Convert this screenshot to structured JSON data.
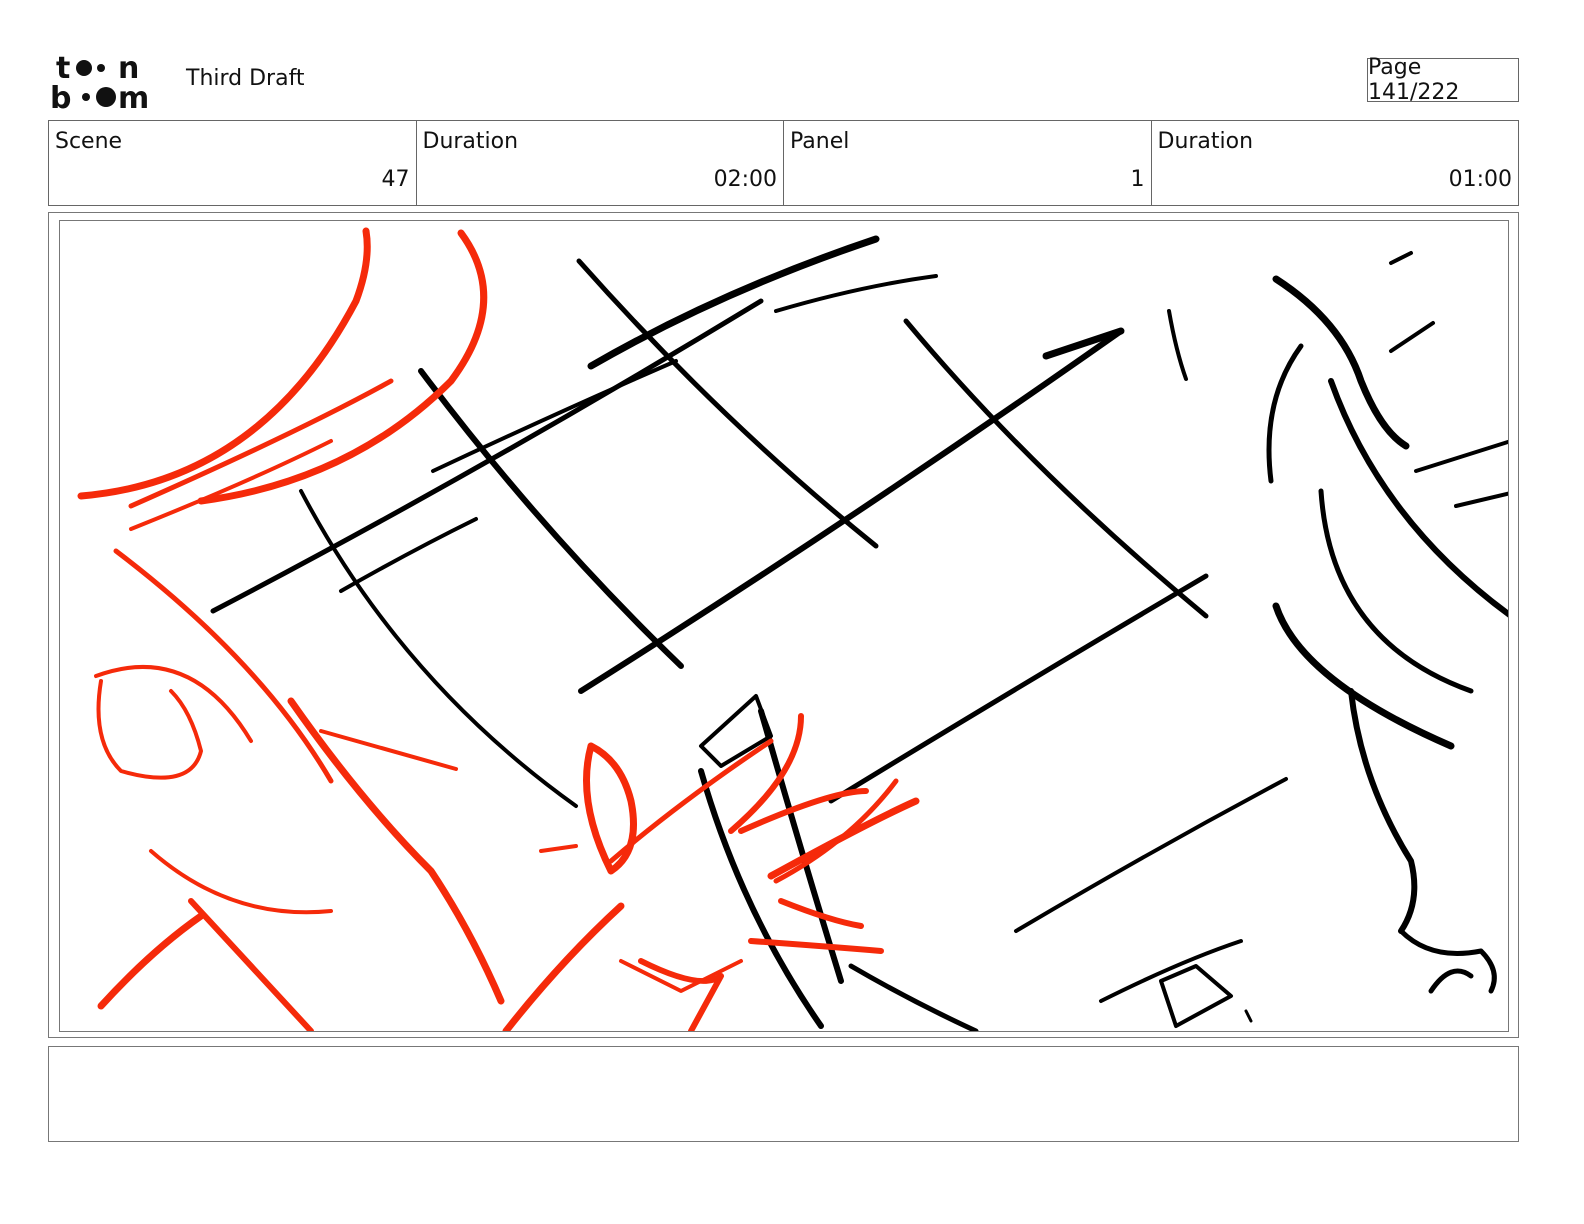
{
  "header": {
    "logo": "toon boom",
    "title": "Third Draft",
    "page_label": "Page 141/222"
  },
  "info": {
    "scene_label": "Scene",
    "scene_value": "47",
    "scene_duration_label": "Duration",
    "scene_duration_value": "02:00",
    "panel_label": "Panel",
    "panel_value": "1",
    "panel_duration_label": "Duration",
    "panel_duration_value": "01:00"
  },
  "sketch": {
    "ink_color": "#000000",
    "red_color": "#f52a0a"
  },
  "notes": {
    "text": ""
  }
}
